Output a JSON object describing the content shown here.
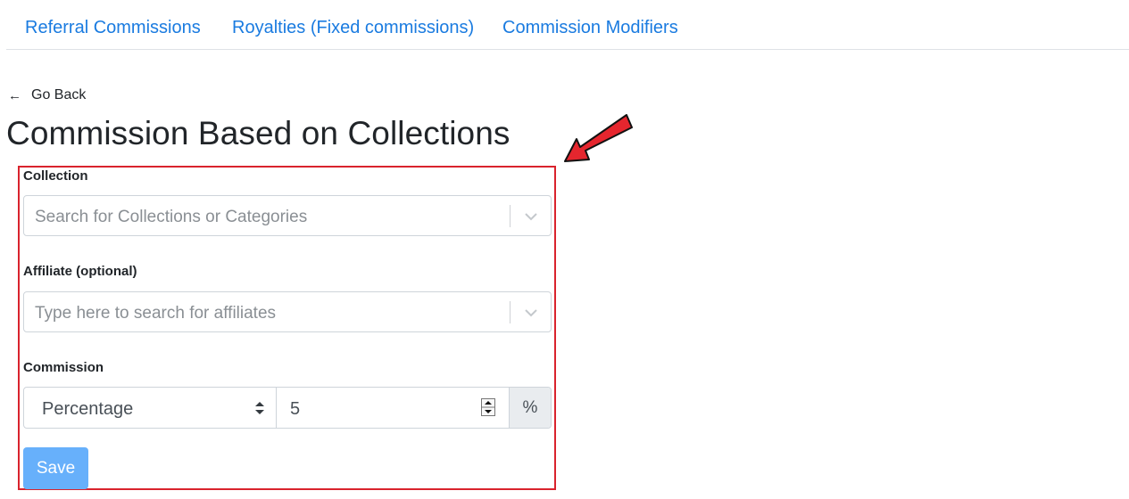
{
  "tabs": [
    {
      "label": "Referral Commissions"
    },
    {
      "label": "Royalties (Fixed commissions)"
    },
    {
      "label": "Commission Modifiers"
    }
  ],
  "back": {
    "label": "Go Back",
    "icon": "arrow-left-icon"
  },
  "page": {
    "title": "Commission Based on Collections"
  },
  "form": {
    "collection": {
      "label": "Collection",
      "placeholder": "Search for Collections or Categories"
    },
    "affiliate": {
      "label": "Affiliate (optional)",
      "placeholder": "Type here to search for affiliates"
    },
    "commission": {
      "label": "Commission",
      "type_value": "Percentage",
      "amount": "5",
      "suffix": "%"
    },
    "save_label": "Save"
  },
  "colors": {
    "link": "#1a7be0",
    "highlight": "#d9232d",
    "save_button": "#67b0fb"
  }
}
